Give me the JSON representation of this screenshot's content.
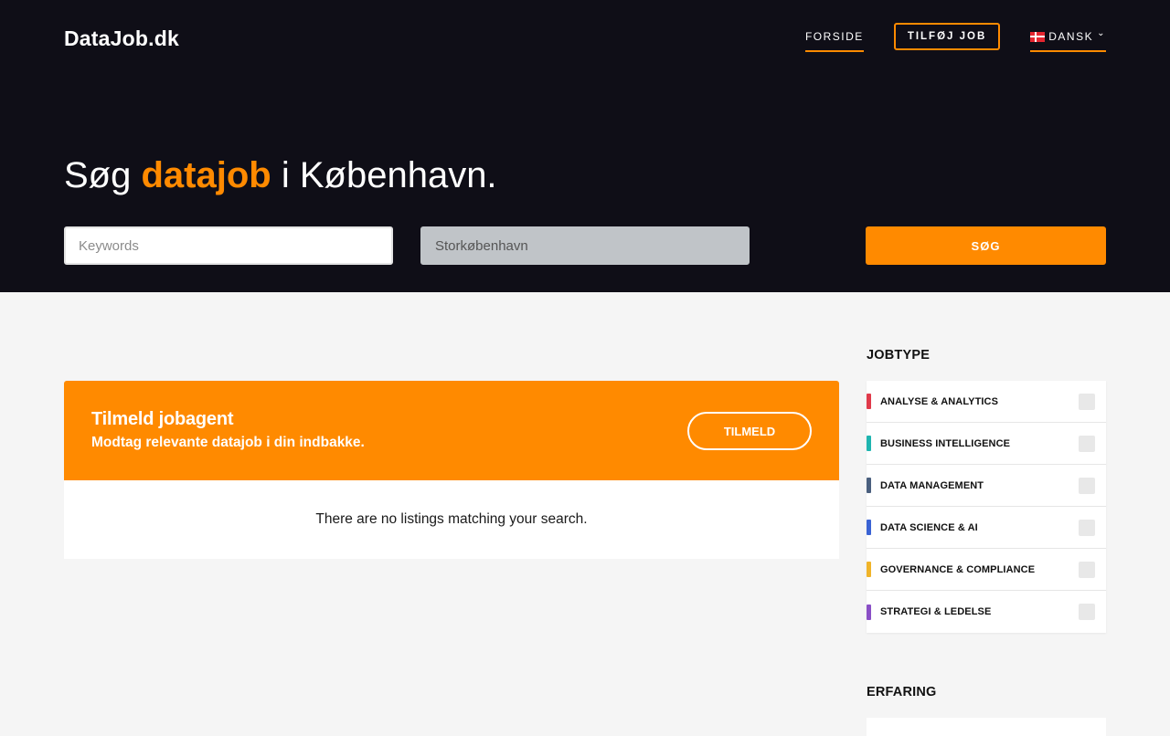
{
  "brand": {
    "logo": "DataJob.dk",
    "accent_color": "#ff8a00",
    "dark_bg": "#0f0e17"
  },
  "nav": {
    "forside": "FORSIDE",
    "add_job": "TILFØJ JOB",
    "language": "DANSK",
    "language_flag": "danish-flag-icon"
  },
  "hero": {
    "headline_prefix": "Søg",
    "headline_accent": "datajob",
    "headline_suffix": "i København."
  },
  "search": {
    "keywords_placeholder": "Keywords",
    "keywords_value": "",
    "location_placeholder": "Storkøbenhavn",
    "location_value": "",
    "button_label": "SØG"
  },
  "agent": {
    "title": "Tilmeld jobagent",
    "subtitle": "Modtag relevante datajob i din indbakke.",
    "button_label": "TILMELD"
  },
  "results": {
    "empty_message": "There are no listings matching your search."
  },
  "sidebar": {
    "jobtype_heading": "JOBTYPE",
    "jobtypes": [
      {
        "label": "Analyse & Analytics",
        "color": "#e03a4a",
        "checked": false
      },
      {
        "label": "Business Intelligence",
        "color": "#1fb5b0",
        "checked": false
      },
      {
        "label": "Data Management",
        "color": "#4a5f7e",
        "checked": false
      },
      {
        "label": "Data Science & AI",
        "color": "#3a63d4",
        "checked": false
      },
      {
        "label": "Governance & Compliance",
        "color": "#f0b429",
        "checked": false
      },
      {
        "label": "Strategi & Ledelse",
        "color": "#8a4fc6",
        "checked": false
      }
    ],
    "erfaring_heading": "ERFARING"
  }
}
